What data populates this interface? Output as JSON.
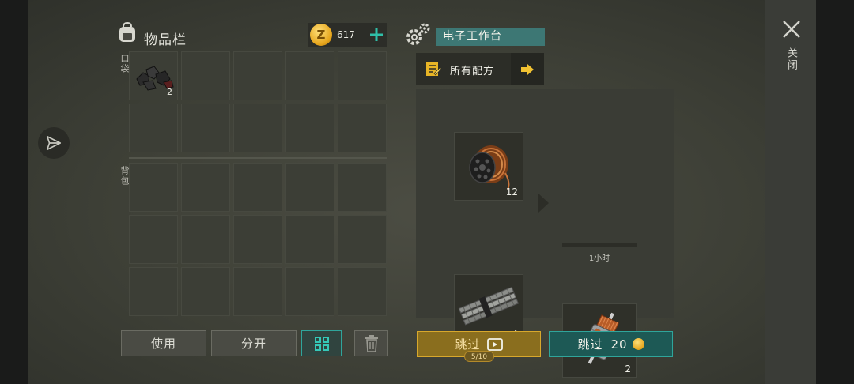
{
  "inventory": {
    "title": "物品栏",
    "pockets_label": "口袋",
    "backpack_label": "背包",
    "coins": "617",
    "pockets": [
      {
        "item": "coal-icon",
        "count": "2"
      },
      {
        "item": "",
        "count": ""
      },
      {
        "item": "",
        "count": ""
      },
      {
        "item": "",
        "count": ""
      },
      {
        "item": "",
        "count": ""
      },
      {
        "item": "",
        "count": ""
      },
      {
        "item": "",
        "count": ""
      },
      {
        "item": "",
        "count": ""
      },
      {
        "item": "",
        "count": ""
      },
      {
        "item": "",
        "count": ""
      }
    ],
    "backpack_slots": 15,
    "use_label": "使用",
    "split_label": "分开"
  },
  "workbench": {
    "title": "电子工作台",
    "all_recipes_label": "所有配方",
    "ingredients": [
      {
        "icon": "copper-wire-spool-icon",
        "count": "12"
      },
      {
        "icon": "steel-rebar-icon",
        "count": "4"
      }
    ],
    "result": {
      "icon": "electric-motor-icon",
      "count": "2",
      "time": "1小时"
    },
    "skip_ad_label": "跳过",
    "skip_ad_progress": "5/10",
    "skip_coin_label": "跳过",
    "skip_coin_cost": "20"
  },
  "close_label": "关闭",
  "colors": {
    "accent_teal": "#2fa59b",
    "accent_yellow": "#d8a82c",
    "coin_gold": "#e6a51c"
  }
}
